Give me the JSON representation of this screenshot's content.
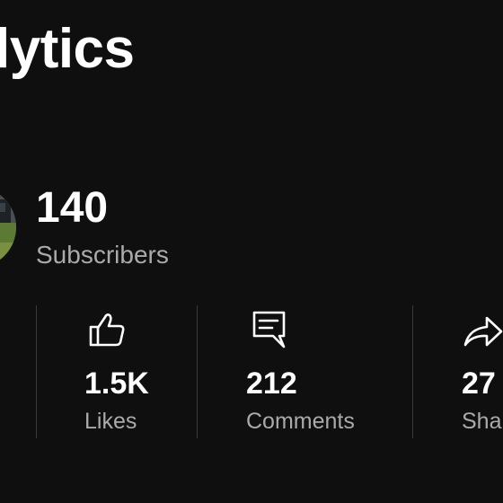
{
  "header": {
    "title": "alytics"
  },
  "channel": {
    "subscribers_count": "140",
    "subscribers_label": "Subscribers"
  },
  "stats": [
    {
      "icon": "thumbs-up-icon",
      "value": "1.5K",
      "label": "Likes"
    },
    {
      "icon": "comment-icon",
      "value": "212",
      "label": "Comments"
    },
    {
      "icon": "share-icon",
      "value": "27",
      "label": "Sha"
    }
  ],
  "colors": {
    "background": "#0f0f0f",
    "primary_text": "#ffffff",
    "secondary_text": "#aaaaaa",
    "divider": "#3a3a3a"
  }
}
